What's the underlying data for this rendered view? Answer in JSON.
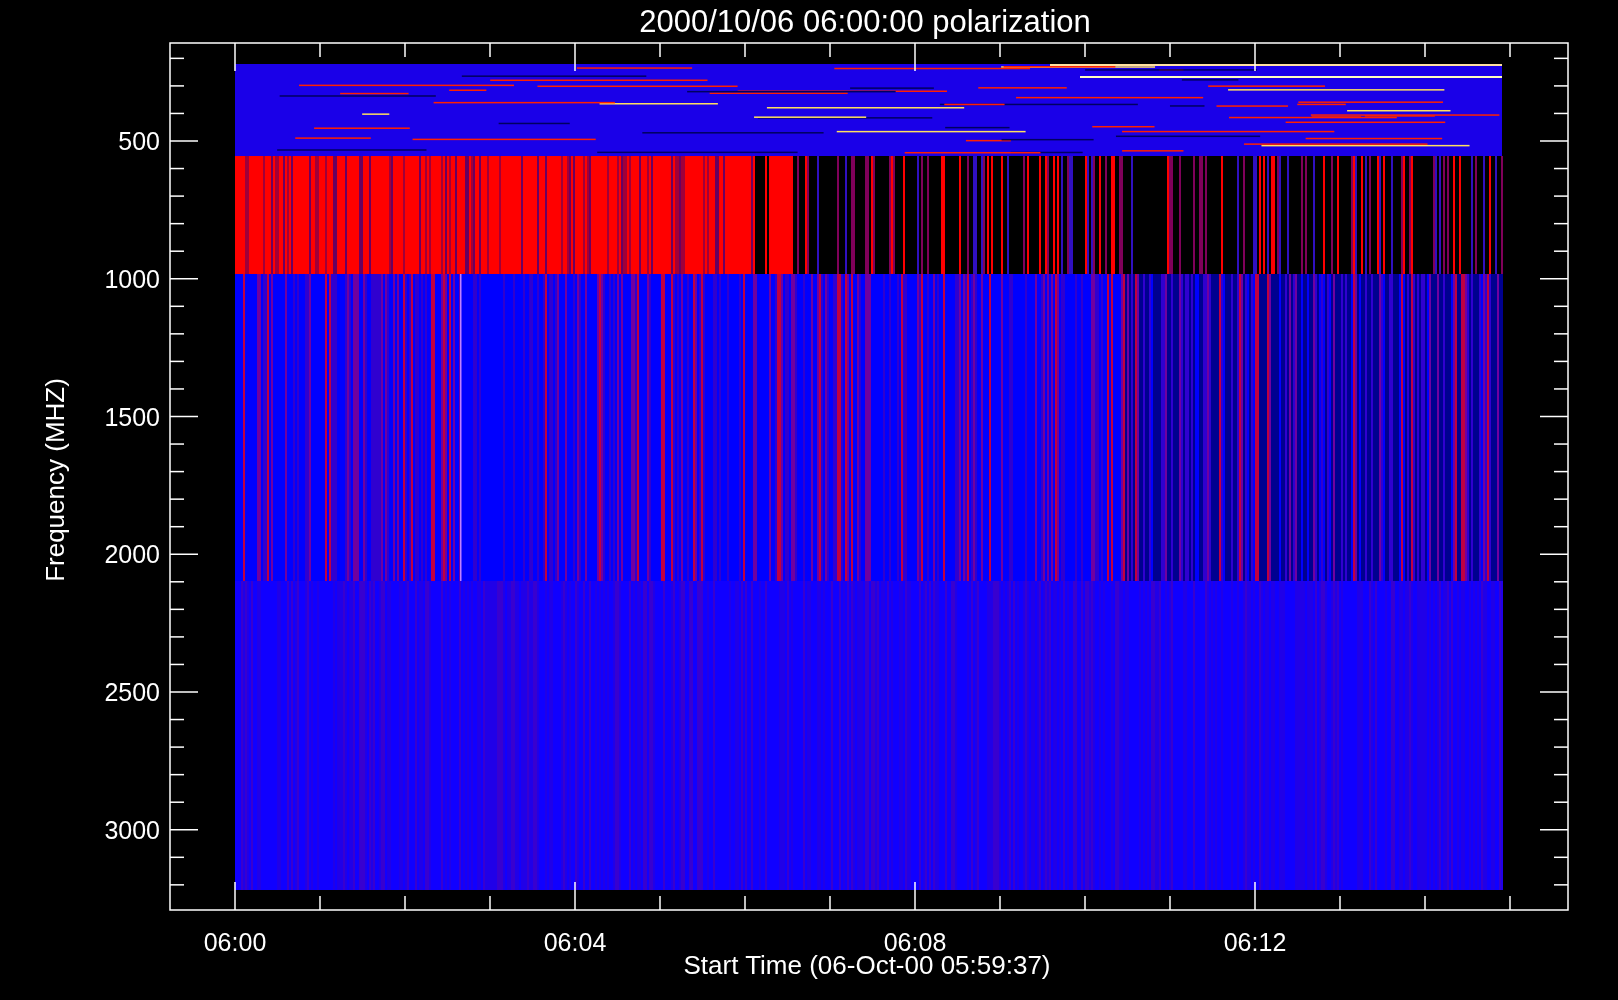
{
  "title": "2000/10/06 06:00:00 polarization",
  "y_axis": {
    "label": "Frequency (MHZ)",
    "ticks": [
      "500",
      "1000",
      "1500",
      "2000",
      "2500",
      "3000"
    ]
  },
  "x_axis": {
    "label": "Start Time (06-Oct-00 05:59:37)",
    "ticks": [
      "06:00",
      "06:04",
      "06:08",
      "06:12"
    ]
  }
}
